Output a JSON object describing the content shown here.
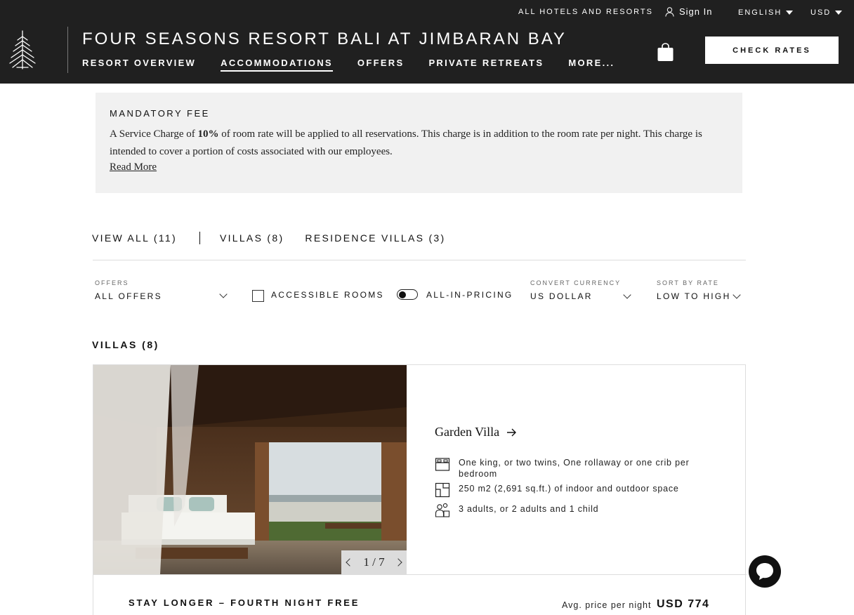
{
  "header": {
    "all_hotels": "ALL HOTELS AND RESORTS",
    "sign_in": "Sign In",
    "language": "ENGLISH",
    "currency": "USD",
    "title": "FOUR SEASONS RESORT BALI AT JIMBARAN BAY",
    "nav": [
      {
        "label": "RESORT OVERVIEW",
        "active": false
      },
      {
        "label": "ACCOMMODATIONS",
        "active": true
      },
      {
        "label": "OFFERS",
        "active": false
      },
      {
        "label": "PRIVATE RETREATS",
        "active": false
      },
      {
        "label": "MORE...",
        "active": false
      }
    ],
    "check_rates": "CHECK RATES",
    "icons": {
      "logo": "four-seasons-tree-logo",
      "user": "user-icon",
      "bag": "shopping-bag-icon"
    }
  },
  "fee": {
    "title": "MANDATORY FEE",
    "text_before": "A Service Charge of ",
    "percent": "10%",
    "text_after": " of room rate will be applied to all reservations. This charge is in addition to the room rate per night. This charge is intended to cover a portion of costs associated with our employees.",
    "read_more": "Read More"
  },
  "tabs": {
    "view_all": "VIEW ALL (11)",
    "villas": "VILLAS (8)",
    "residence_villas": "RESIDENCE VILLAS (3)"
  },
  "filters": {
    "offers_label": "OFFERS",
    "offers_value": "ALL OFFERS",
    "accessible": "ACCESSIBLE ROOMS",
    "all_in_pricing": "ALL-IN-PRICING",
    "currency_label": "CONVERT CURRENCY",
    "currency_value": "US DOLLAR",
    "sort_label": "SORT BY RATE",
    "sort_value": "LOW TO HIGH"
  },
  "section": {
    "heading": "VILLAS (8)"
  },
  "room": {
    "name": "Garden Villa",
    "beds": "One king, or two twins, One rollaway or one crib per bedroom",
    "size": "250 m2 (2,691 sq.ft.) of indoor and outdoor space",
    "occupancy": "3 adults, or 2 adults and 1 child",
    "gallery_counter": "1 / 7",
    "offer_name": "STAY LONGER – FOURTH NIGHT FREE",
    "avg_label": "Avg. price per night",
    "avg_price": "USD 774"
  },
  "colors": {
    "header_bg": "#202020",
    "fee_bg": "#f1f1f1",
    "accent": "#111111"
  }
}
